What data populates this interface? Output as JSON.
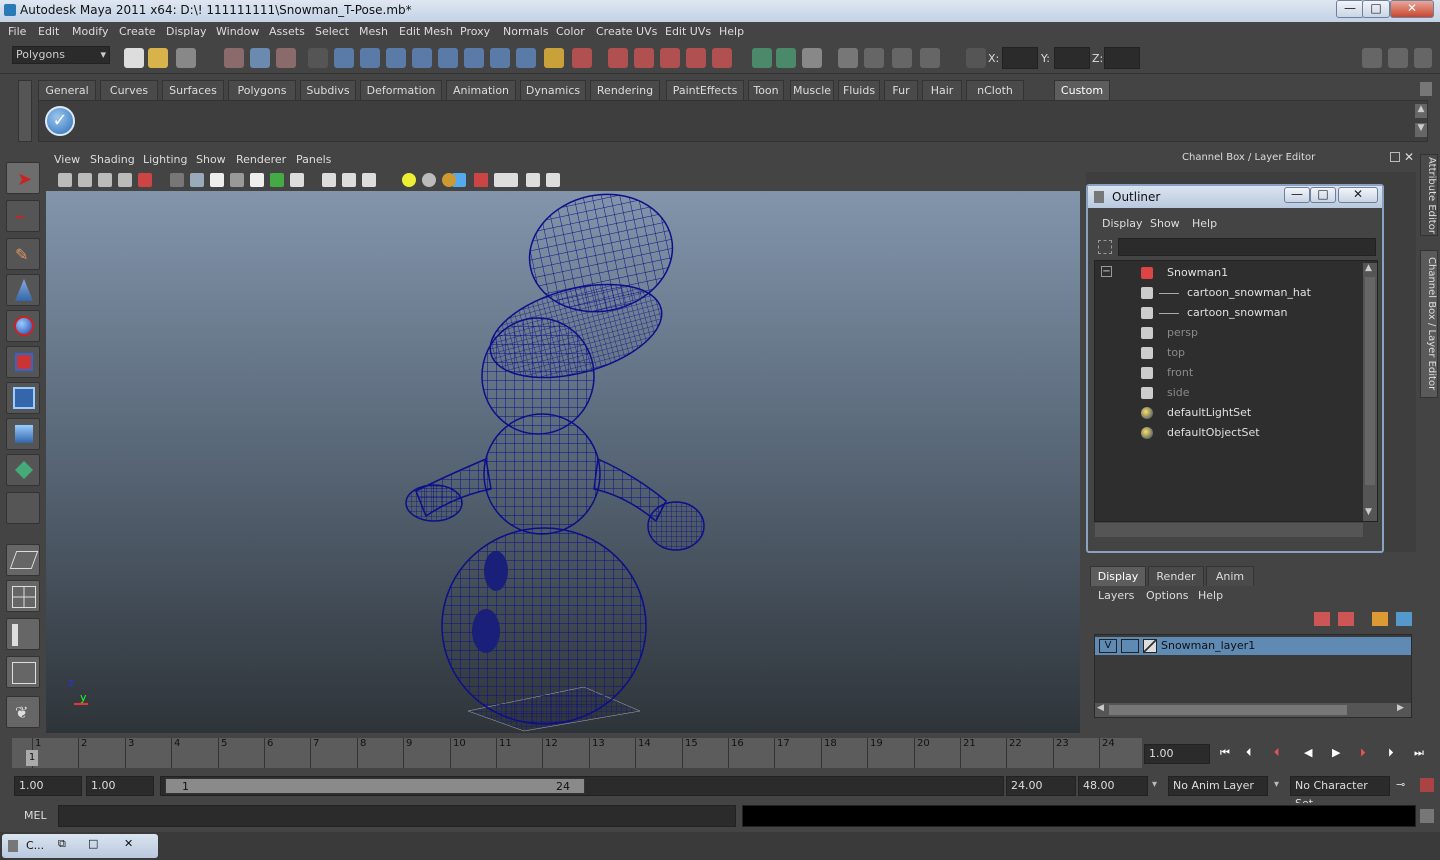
{
  "window": {
    "title": "Autodesk Maya 2011 x64: D:\\! 111111111\\Snowman_T-Pose.mb*",
    "controls": {
      "minimize": "—",
      "maximize": "□",
      "close": "✕"
    }
  },
  "menu": [
    "File",
    "Edit",
    "Modify",
    "Create",
    "Display",
    "Window",
    "Assets",
    "Select",
    "Mesh",
    "Edit Mesh",
    "Proxy",
    "Normals",
    "Color",
    "Create UVs",
    "Edit UVs",
    "Help"
  ],
  "status_line": {
    "mode": "Polygons",
    "x_label": "X:",
    "y_label": "Y:",
    "z_label": "Z:"
  },
  "shelf_tabs": [
    "General",
    "Curves",
    "Surfaces",
    "Polygons",
    "Subdivs",
    "Deformation",
    "Animation",
    "Dynamics",
    "Rendering",
    "PaintEffects",
    "Toon",
    "Muscle",
    "Fluids",
    "Fur",
    "Hair",
    "nCloth",
    "Custom"
  ],
  "shelf_active": "Custom",
  "viewport": {
    "menu": [
      "View",
      "Shading",
      "Lighting",
      "Show",
      "Renderer",
      "Panels"
    ],
    "axis": {
      "x": "x",
      "y": "y",
      "z": "z"
    }
  },
  "channel_box": {
    "title": "Channel Box / Layer Editor"
  },
  "side_tabs": [
    "Attribute Editor",
    "Channel Box / Layer Editor"
  ],
  "outliner": {
    "title": "Outliner",
    "menu": [
      "Display",
      "Show",
      "Help"
    ],
    "items": [
      {
        "label": "Snowman1",
        "level": 0,
        "expanded": true,
        "dim": false,
        "icon": "group-icon"
      },
      {
        "label": "cartoon_snowman_hat",
        "level": 1,
        "dim": false,
        "icon": "mesh-icon"
      },
      {
        "label": "cartoon_snowman",
        "level": 1,
        "dim": false,
        "icon": "mesh-icon"
      },
      {
        "label": "persp",
        "level": 0,
        "dim": true,
        "icon": "camera-icon"
      },
      {
        "label": "top",
        "level": 0,
        "dim": true,
        "icon": "camera-icon"
      },
      {
        "label": "front",
        "level": 0,
        "dim": true,
        "icon": "camera-icon"
      },
      {
        "label": "side",
        "level": 0,
        "dim": true,
        "icon": "camera-icon"
      },
      {
        "label": "defaultLightSet",
        "level": 0,
        "dim": false,
        "icon": "set-icon"
      },
      {
        "label": "defaultObjectSet",
        "level": 0,
        "dim": false,
        "icon": "set-icon"
      }
    ]
  },
  "layer_editor": {
    "tabs": [
      "Display",
      "Render",
      "Anim"
    ],
    "menu": [
      "Layers",
      "Options",
      "Help"
    ],
    "layer": {
      "visible": "V",
      "name": "Snowman_layer1"
    }
  },
  "timeline": {
    "ticks": [
      "1",
      "2",
      "3",
      "4",
      "5",
      "6",
      "7",
      "8",
      "9",
      "10",
      "11",
      "12",
      "13",
      "14",
      "15",
      "16",
      "17",
      "18",
      "19",
      "20",
      "21",
      "22",
      "23",
      "24"
    ],
    "current_frame_marker": "1",
    "current_time": "1.00"
  },
  "range": {
    "start": "1.00",
    "playback_start": "1.00",
    "slider_min": "1",
    "slider_max": "24",
    "playback_end": "24.00",
    "end": "48.00",
    "anim_layer": "No Anim Layer",
    "character_set": "No Character Set"
  },
  "command": {
    "label": "MEL"
  },
  "taskbar": {
    "item": "C..."
  }
}
